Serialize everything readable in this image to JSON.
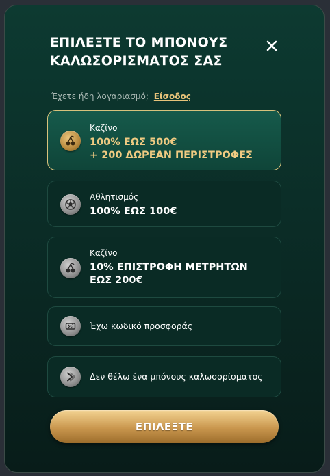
{
  "modal": {
    "title": "ΕΠΙΛΕΞΤΕ ΤΟ ΜΠΟΝΟΥΣ ΚΑΛΩΣΟΡΙΣΜΑΤΟΣ ΣΑΣ",
    "close_icon": "close-icon",
    "login_prompt": "Έχετε ήδη λογαριασμό;",
    "login_link": "Είσοδος"
  },
  "options": [
    {
      "label": "Καζίνο",
      "value_line1": "100% ΕΩΣ 500€",
      "value_line2": "+ 200 ΔΩΡΕΑΝ ΠΕΡΙΣΤΡΟΦΕΣ",
      "icon": "cherry-icon",
      "selected": true
    },
    {
      "label": "Αθλητισμός",
      "value_line1": "100% ΕΩΣ 100€",
      "icon": "football-icon",
      "selected": false
    },
    {
      "label": "Καζίνο",
      "value_line1": "10% ΕΠΙΣΤΡΟΦΗ ΜΕΤΡΗΤΩΝ",
      "value_line2": "ΕΩΣ 200€",
      "icon": "cherry-icon",
      "selected": false
    },
    {
      "label": "Έχω κωδικό προσφοράς",
      "icon": "ticket-icon",
      "selected": false
    },
    {
      "label": "Δεν θέλω ένα μπόνους καλωσορίσματος",
      "icon": "chevron-right-icon",
      "selected": false
    }
  ],
  "submit": {
    "label": "ΕΠΙΛΕΞΤΕ"
  },
  "colors": {
    "accent_gold": "#f0cb82",
    "selected_border": "#d8c27c",
    "background": "#0b2d27"
  }
}
